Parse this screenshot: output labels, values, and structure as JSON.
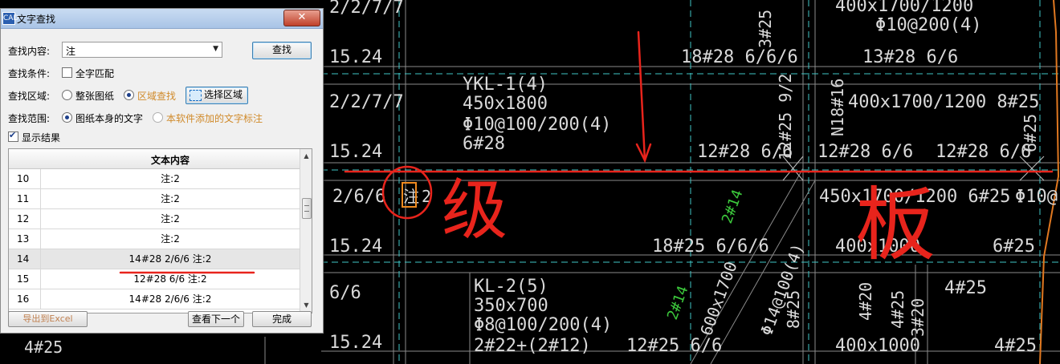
{
  "dialog": {
    "title": "文字查找",
    "app_icon": "CAD",
    "close_glyph": "✕",
    "find_label": "查找内容:",
    "find_value": "注",
    "find_button": "查找",
    "condition_label": "查找条件:",
    "whole_word": "全字匹配",
    "area_label": "查找区域:",
    "area_whole": "整张图纸",
    "area_region": "区域查找",
    "select_area_button": "选择区域",
    "scope_label": "查找范围:",
    "scope_own": "图纸本身的文字",
    "scope_added": "本软件添加的文字标注",
    "show_results": "显示结果",
    "table_header": "文本内容",
    "rows": [
      {
        "num": "10",
        "text": "注:2"
      },
      {
        "num": "11",
        "text": "注:2"
      },
      {
        "num": "12",
        "text": "注:2"
      },
      {
        "num": "13",
        "text": "注:2"
      },
      {
        "num": "14",
        "text": "14#28 2/6/6  注:2"
      },
      {
        "num": "15",
        "text": "12#28 6/6  注:2"
      },
      {
        "num": "16",
        "text": "14#28 2/6/6  注:2"
      }
    ],
    "export_button": "导出到Excel",
    "next_button": "查看下一个",
    "done_button": "完成"
  },
  "cad": {
    "t_1524a": "15.24",
    "t_1524b": "15.24",
    "t_1524c": "15.24",
    "t_1524d": "15.24",
    "t_2277_top": "2/2/7/7",
    "t_2277": "2/2/7/7",
    "t_266": "2/6/6",
    "t_66": "6/6",
    "t_ykl": "YKL-1(4)",
    "t_ykl_size": "450x1800",
    "t_ykl_stir": "Φ10@100/200(4)",
    "t_ykl_bar": "6#28",
    "t_kl": "KL-2(5)",
    "t_kl_size": "350x700",
    "t_kl_stir": "Φ8@100/200(4)",
    "t_kl_bar": "2#22+(2#12)",
    "t_18_28": "18#28 6/6/6",
    "t_13_28": "13#28 6/6",
    "t_12_28a": "12#28 6/6",
    "t_12_28b": "12#28 6/6",
    "t_12_28c": "12#28 6/6",
    "t_18_25": "18#25 6/6/6",
    "t_12_25": "12#25 6/6",
    "t_400_top": "400x1700/1200",
    "t_400_stir": "Φ10@200(4)",
    "t_400_mid": "400x1700/1200  8#25",
    "t_450": "450x1700/1200 6#25",
    "t_phi": "Φ10@",
    "t_400_1000a": "400x1000",
    "t_400_1000b": "400x1000",
    "t_625": "6#25",
    "t_425a": "4#25",
    "t_425b": "4#25",
    "t_425c": "4#25",
    "t_425d": "4#25",
    "t_zhu": "注",
    "t_zhu2": "2",
    "t_ji": "级",
    "t_ban": "板",
    "t_v1": "3#25 N18#",
    "t_v2": "N18#16",
    "t_v3": "12#25 9/2",
    "t_v4": "6#25",
    "t_v5": "8#25",
    "t_v6": "4#20",
    "t_v7": "3#20",
    "t_g1": "2#14",
    "t_g2": "2#14",
    "t_v8": "600x1700",
    "t_v9": "Φ14@100(4)"
  },
  "annotation_color": "#e8241c",
  "accent_color": "#d08a2a"
}
